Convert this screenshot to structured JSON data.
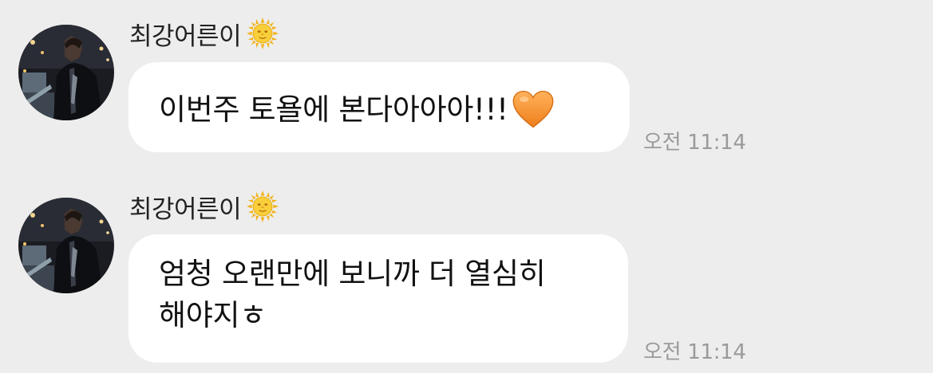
{
  "messages": [
    {
      "sender": "최강어른이",
      "sender_emoji": "sun-with-face-icon",
      "text_lines": [
        "이번주 토욜에 본다아아아!!!"
      ],
      "trailing_emoji": "orange-heart-icon",
      "time": "오전 11:14"
    },
    {
      "sender": "최강어른이",
      "sender_emoji": "sun-with-face-icon",
      "text_lines": [
        "엄청 오랜만에 보니까 더 열심히",
        "해야지ㅎ"
      ],
      "time": "오전 11:14"
    }
  ],
  "colors": {
    "background": "#ededed",
    "bubble": "#ffffff",
    "timestamp": "#9a9a9a",
    "heart": "#f5932e",
    "sun": "#f6c324"
  }
}
